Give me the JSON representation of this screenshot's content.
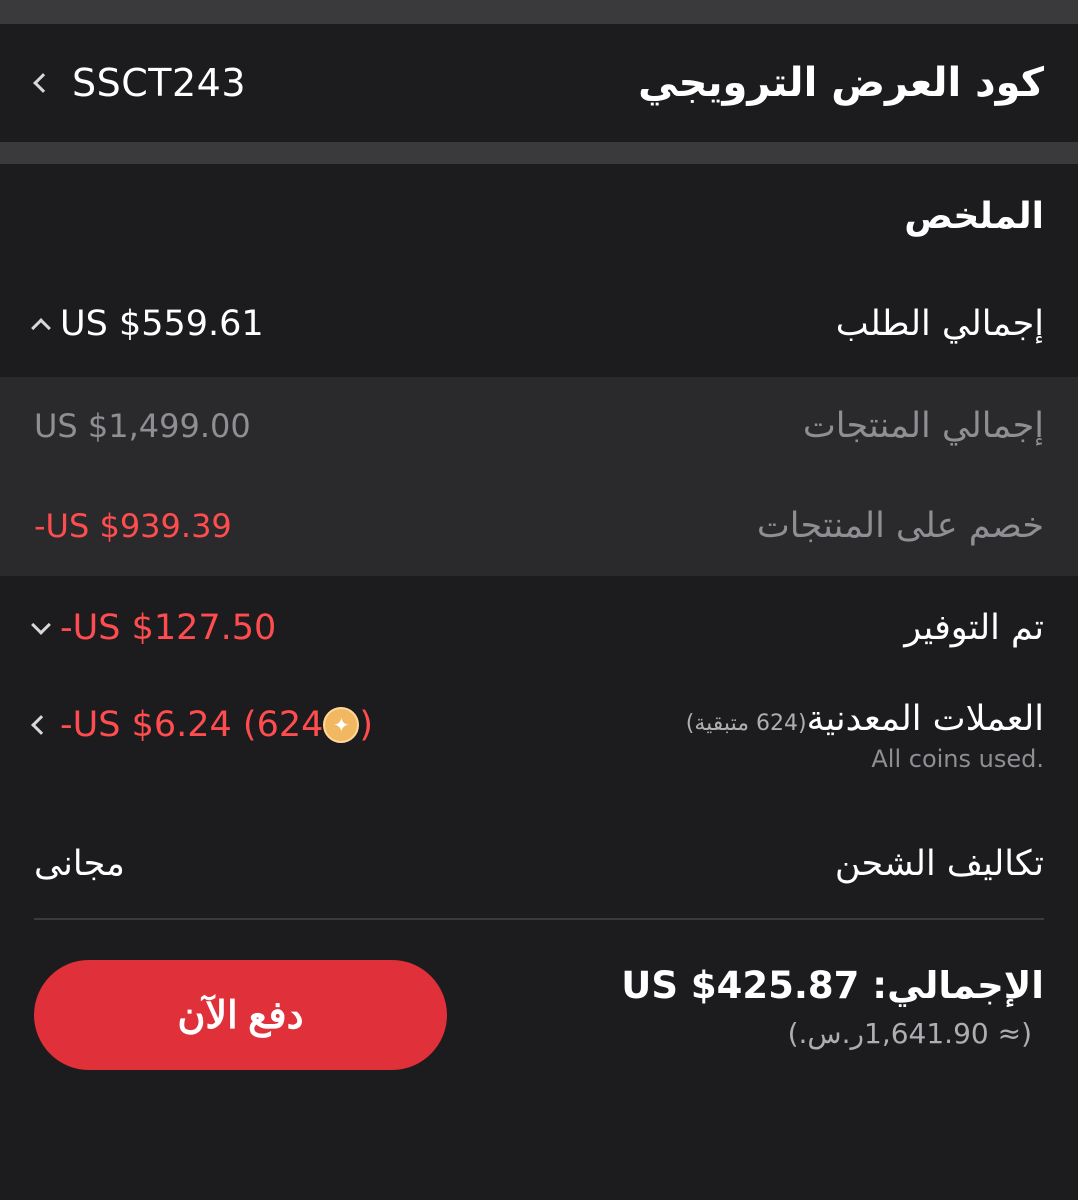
{
  "promo": {
    "title": "كود العرض الترويجي",
    "code": "SSCT243"
  },
  "summary": {
    "title": "الملخص",
    "order_total": {
      "label": "إجمالي الطلب",
      "value": "US $559.61"
    },
    "products_total": {
      "label": "إجمالي المنتجات",
      "value": "US $1,499.00"
    },
    "products_discount": {
      "label": "خصم على المنتجات",
      "value": "-US $939.39"
    },
    "saved": {
      "label": "تم التوفير",
      "value": "-US $127.50"
    },
    "coins": {
      "label": "العملات المعدنية",
      "remaining": "(624 متبقية)",
      "note": "All coins used.",
      "value_prefix": "-US $6.24 (624",
      "value_suffix": ")"
    },
    "shipping": {
      "label": "تكاليف الشحن",
      "value": "مجانى"
    }
  },
  "footer": {
    "total": "الإجمالي: US $425.87",
    "approx": "(≈ 1,641.90ر.س.)",
    "pay_label": "دفع الآن"
  },
  "colors": {
    "accent": "#e0303a",
    "negative": "#ff4d4f",
    "coin": "#f2b861"
  },
  "icons": {
    "back": "chevron-left-icon",
    "collapse": "chevron-up-icon",
    "expand": "chevron-down-icon",
    "coin": "coin-icon"
  }
}
